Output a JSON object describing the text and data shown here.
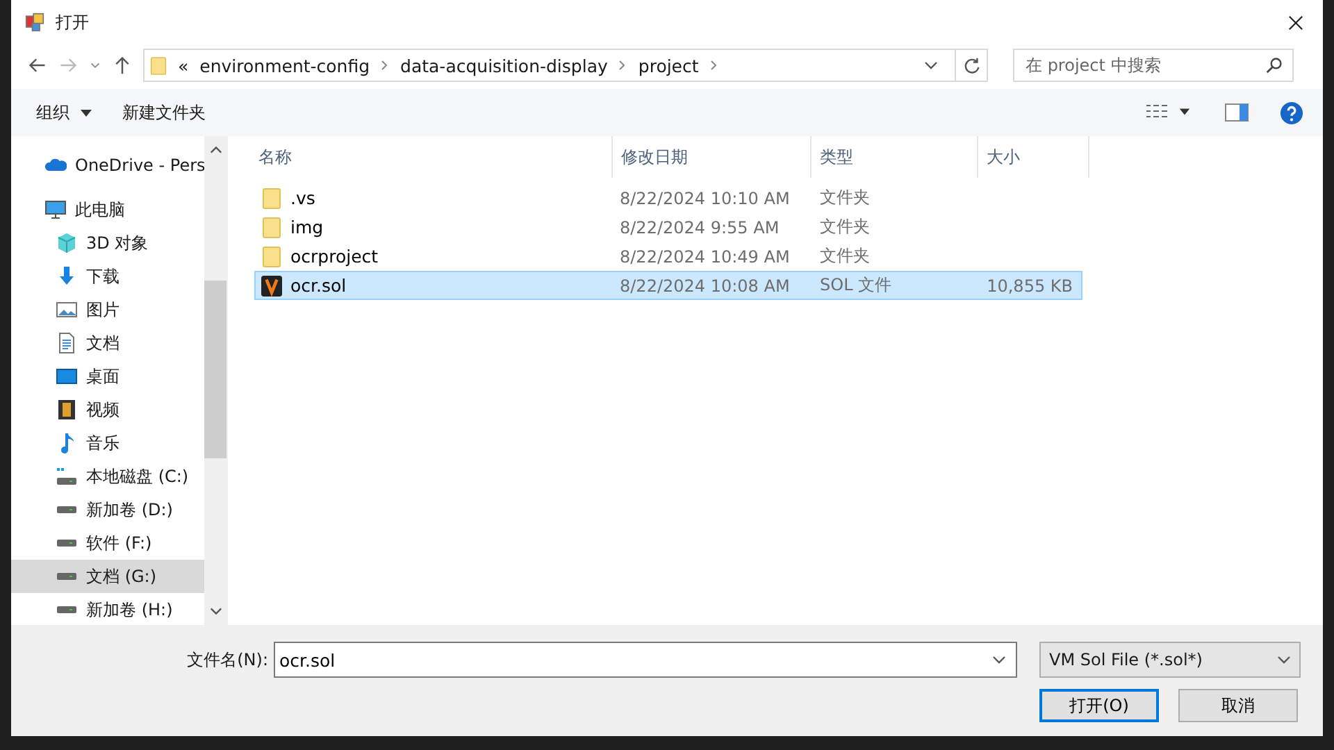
{
  "window": {
    "title": "打开"
  },
  "address": {
    "overflow": "«",
    "path": [
      "environment-config",
      "data-acquisition-display",
      "project"
    ]
  },
  "search": {
    "placeholder": "在 project 中搜索"
  },
  "toolbar": {
    "organize": "组织",
    "new_folder": "新建文件夹"
  },
  "nav": [
    {
      "kind": "cloud",
      "label": "OneDrive - Pers",
      "selected": false
    },
    {
      "kind": "pc",
      "label": "此电脑",
      "selected": false,
      "children": [
        {
          "kind": "cube",
          "label": "3D 对象",
          "selected": false
        },
        {
          "kind": "download",
          "label": "下载",
          "selected": false
        },
        {
          "kind": "image",
          "label": "图片",
          "selected": false
        },
        {
          "kind": "doc",
          "label": "文档",
          "selected": false
        },
        {
          "kind": "desktop",
          "label": "桌面",
          "selected": false
        },
        {
          "kind": "video",
          "label": "视频",
          "selected": false
        },
        {
          "kind": "music",
          "label": "音乐",
          "selected": false
        },
        {
          "kind": "sysdrive",
          "label": "本地磁盘 (C:)",
          "selected": false
        },
        {
          "kind": "drive",
          "label": "新加卷 (D:)",
          "selected": false
        },
        {
          "kind": "drive",
          "label": "软件 (F:)",
          "selected": false
        },
        {
          "kind": "drive",
          "label": "文档 (G:)",
          "selected": true
        },
        {
          "kind": "drive",
          "label": "新加卷 (H:)",
          "selected": false
        }
      ]
    }
  ],
  "columns": [
    "名称",
    "修改日期",
    "类型",
    "大小"
  ],
  "files": [
    {
      "kind": "folder",
      "name": ".vs",
      "date": "8/22/2024 10:10 AM",
      "type": "文件夹",
      "selected": false
    },
    {
      "kind": "folder",
      "name": "img",
      "date": "8/22/2024 9:55 AM",
      "type": "文件夹",
      "selected": false
    },
    {
      "kind": "folder",
      "name": "ocrproject",
      "date": "8/22/2024 10:49 AM",
      "type": "文件夹",
      "selected": false
    },
    {
      "kind": "sol",
      "name": "ocr.sol",
      "date": "8/22/2024 10:08 AM",
      "type": "SOL 文件",
      "size": "10,855 KB",
      "selected": true
    }
  ],
  "footer": {
    "filename_label": "文件名(N):",
    "filename": "ocr.sol",
    "filter": "VM Sol File (*.sol*)",
    "open": "打开(O)",
    "cancel": "取消"
  }
}
